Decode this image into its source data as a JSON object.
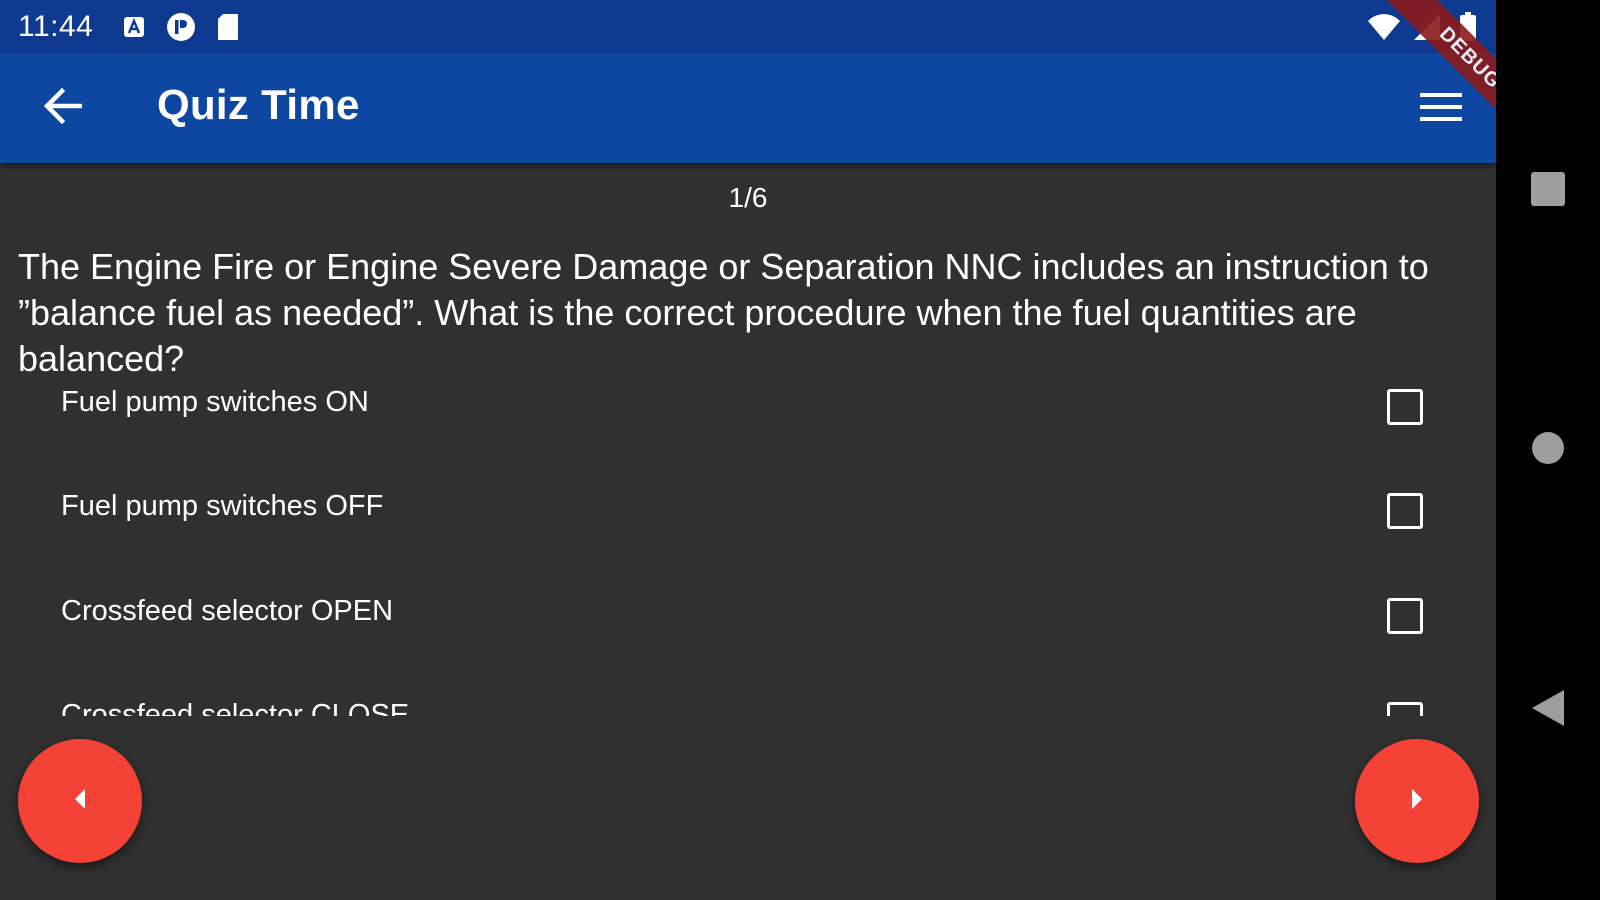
{
  "status_bar": {
    "time": "11:44",
    "icons": [
      "notification-a-icon",
      "notification-p-icon",
      "sd-card-icon",
      "wifi-icon",
      "signal-icon",
      "battery-icon"
    ]
  },
  "debug_banner": "DEBUG",
  "app_bar": {
    "title": "Quiz Time",
    "back_icon": "arrow-back-icon",
    "menu_icon": "menu-icon"
  },
  "quiz": {
    "progress": "1/6",
    "question": "The Engine Fire or Engine Severe Damage or Separation NNC includes an instruction to ”balance fuel as needed”. What is the correct procedure when the fuel quantities are balanced?",
    "options": [
      {
        "label": "Fuel pump switches ON",
        "checked": false
      },
      {
        "label": "Fuel pump switches OFF",
        "checked": false
      },
      {
        "label": "Crossfeed selector OPEN",
        "checked": false
      },
      {
        "label": "Crossfeed selector CLOSE",
        "checked": false
      }
    ]
  },
  "buttons": {
    "prev_icon": "arrow-left-icon",
    "next_icon": "arrow-right-icon"
  },
  "colors": {
    "status_bar": "#0d3a8f",
    "app_bar": "#0d47a1",
    "background": "#303030",
    "fab": "#f44336"
  },
  "system_nav": {
    "icons": [
      "recents-icon",
      "home-icon",
      "back-icon"
    ]
  }
}
